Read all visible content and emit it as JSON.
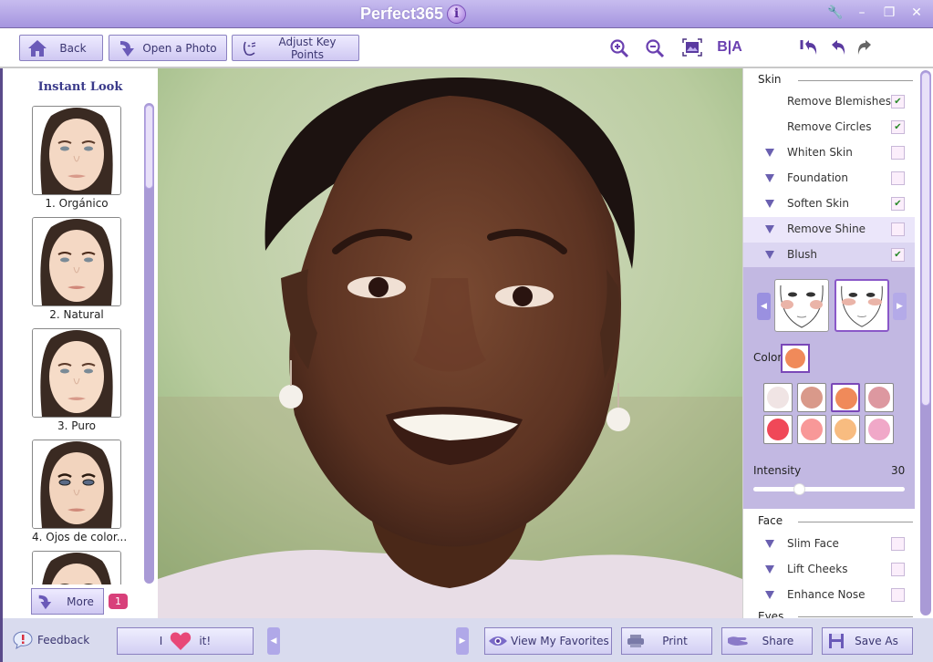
{
  "app": {
    "title": "Perfect365"
  },
  "toolbar": {
    "back": "Back",
    "open_photo": "Open a Photo",
    "adjust_key_points": "Adjust Key Points",
    "before_after": "B|A"
  },
  "instant_look": {
    "title": "Instant Look",
    "looks": [
      {
        "label": "1. Orgánico"
      },
      {
        "label": "2. Natural"
      },
      {
        "label": "3. Puro"
      },
      {
        "label": "4. Ojos de color..."
      }
    ],
    "more_label": "More",
    "badge_count": "1"
  },
  "right_panel": {
    "skin_header": "Skin",
    "skin_options": [
      {
        "label": "Remove Blemishes",
        "expandable": false,
        "checked": true
      },
      {
        "label": "Remove Circles",
        "expandable": false,
        "checked": true
      },
      {
        "label": "Whiten Skin",
        "expandable": true,
        "checked": false
      },
      {
        "label": "Foundation",
        "expandable": true,
        "checked": false
      },
      {
        "label": "Soften Skin",
        "expandable": true,
        "checked": true
      },
      {
        "label": "Remove Shine",
        "expandable": true,
        "checked": false
      },
      {
        "label": "Blush",
        "expandable": true,
        "checked": true
      }
    ],
    "blush": {
      "color_label": "Color",
      "selected_color": "#f08a5a",
      "swatches": [
        "#f0e4e4",
        "#d9998a",
        "#f08a5a",
        "#dd98a0",
        "#f04858",
        "#f89898",
        "#f8bc80",
        "#f0a8c8"
      ],
      "selected_swatch_index": 2,
      "selected_style_index": 1,
      "intensity_label": "Intensity",
      "intensity_value": "30",
      "intensity_fraction": 0.3
    },
    "face_header": "Face",
    "face_options": [
      {
        "label": "Slim Face",
        "checked": false
      },
      {
        "label": "Lift Cheeks",
        "checked": false
      },
      {
        "label": "Enhance Nose",
        "checked": false
      }
    ],
    "eyes_header": "Eyes"
  },
  "statusbar": {
    "feedback": "Feedback",
    "i_label": "I",
    "it_label": "it!",
    "view_favorites": "View My Favorites",
    "print": "Print",
    "share": "Share",
    "save_as": "Save As"
  },
  "colors": {
    "accent": "#a595df",
    "title_bar": "#b6a8e8"
  }
}
